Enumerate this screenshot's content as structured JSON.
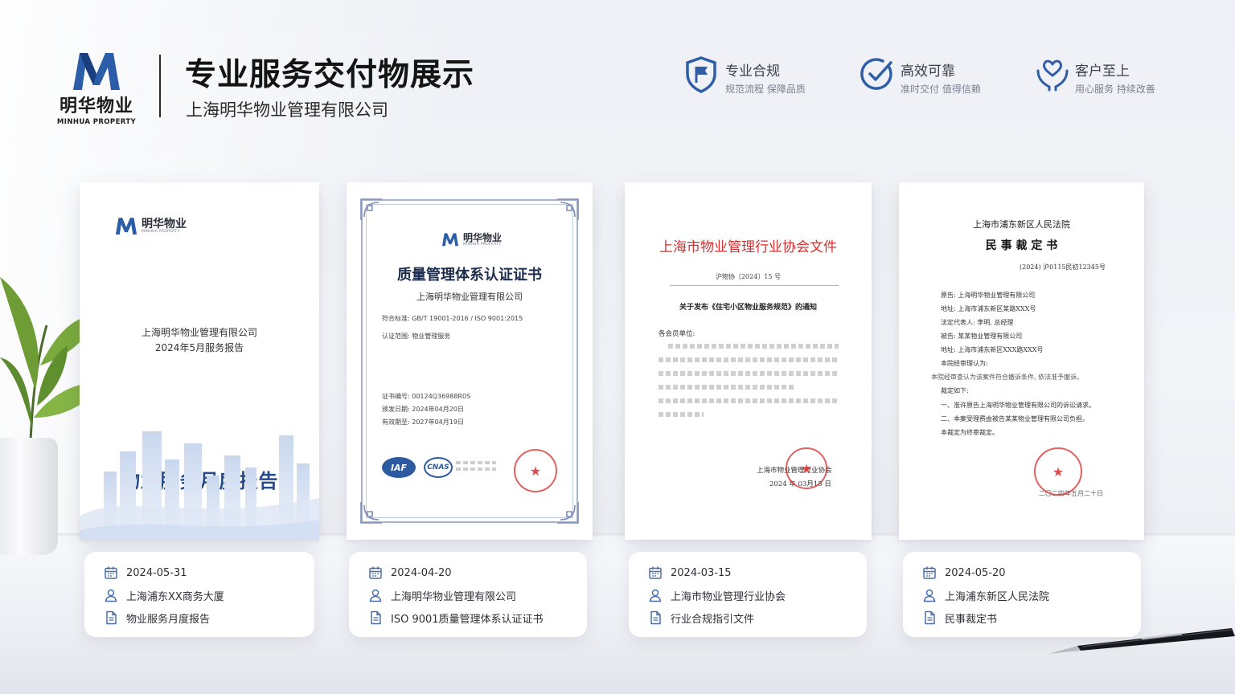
{
  "header": {
    "logo_cn": "明华物业",
    "logo_en": "MINHUA PROPERTY",
    "title": "专业服务交付物展示",
    "subtitle": "上海明华物业管理有限公司"
  },
  "features": [
    {
      "icon": "shield-flag-icon",
      "title": "专业合规",
      "sub": "规范流程  保障品质"
    },
    {
      "icon": "check-circle-icon",
      "title": "高效可靠",
      "sub": "准时交付  值得信赖"
    },
    {
      "icon": "heart-hands-icon",
      "title": "客户至上",
      "sub": "用心服务  持续改善"
    }
  ],
  "colors": {
    "brand": "#254b8d",
    "stamp": "#d62e2e",
    "accent": "#2f5da6"
  },
  "doc1": {
    "logo_cn": "明华物业",
    "logo_en": "MINHUA PROPERTY",
    "title": "物业服务月度报告",
    "company": "上海明华物业管理有限公司",
    "period": "2024年5月服务报告"
  },
  "doc2": {
    "logo_cn": "明华物业",
    "logo_en": "MINHUA PROPERTY",
    "title": "质量管理体系认证证书",
    "company": "上海明华物业管理有限公司",
    "standard": "符合标准:   GB/T 19001-2016 / ISO 9001:2015",
    "scope": "认证范围:   物业管理服务",
    "cert_no": "证书编号:   00124Q36988R0S",
    "issue": "颁发日期:   2024年04月20日",
    "valid": "有效期至:   2027年04月19日",
    "iaf": "IAF",
    "cnas": "CNAS"
  },
  "doc3": {
    "title": "上海市物业管理行业协会文件",
    "number": "沪物协〔2024〕15 号",
    "subject": "关于发布《住宅小区物业服务规范》的通知",
    "greeting": "各会员单位:",
    "sign_org": "上海市物业管理行业协会",
    "sign_date": "2024 年 03月15 日"
  },
  "doc4": {
    "court": "上海市浦东新区人民法院",
    "title": "民 事 裁 定 书",
    "case_no": "(2024) 沪0115民初12345号",
    "lines": [
      "原告: 上海明华物业管理有限公司",
      "地址: 上海市浦东新区某路XXX号",
      "法定代表人: 李明, 总经理",
      "被告: 某某物业管理有限公司",
      "地址: 上海市浦东新区XXX路XXX号",
      "本院经审理认为:",
      "本院经审查认为该案件符合撤诉条件, 依法准予撤诉。",
      "裁定如下:",
      "一、准许原告上海明华物业管理有限公司的诉讼请求。",
      "二、本案受理费由被告某某物业管理有限公司负担。",
      "本裁定为终审裁定。"
    ],
    "date": "二〇二四年五月二十日"
  },
  "info_cards": [
    {
      "date": "2024-05-31",
      "party": "上海浦东XX商务大厦",
      "doc": "物业服务月度报告"
    },
    {
      "date": "2024-04-20",
      "party": "上海明华物业管理有限公司",
      "doc": "ISO 9001质量管理体系认证证书"
    },
    {
      "date": "2024-03-15",
      "party": "上海市物业管理行业协会",
      "doc": "行业合规指引文件"
    },
    {
      "date": "2024-05-20",
      "party": "上海浦东新区人民法院",
      "doc": "民事裁定书"
    }
  ]
}
